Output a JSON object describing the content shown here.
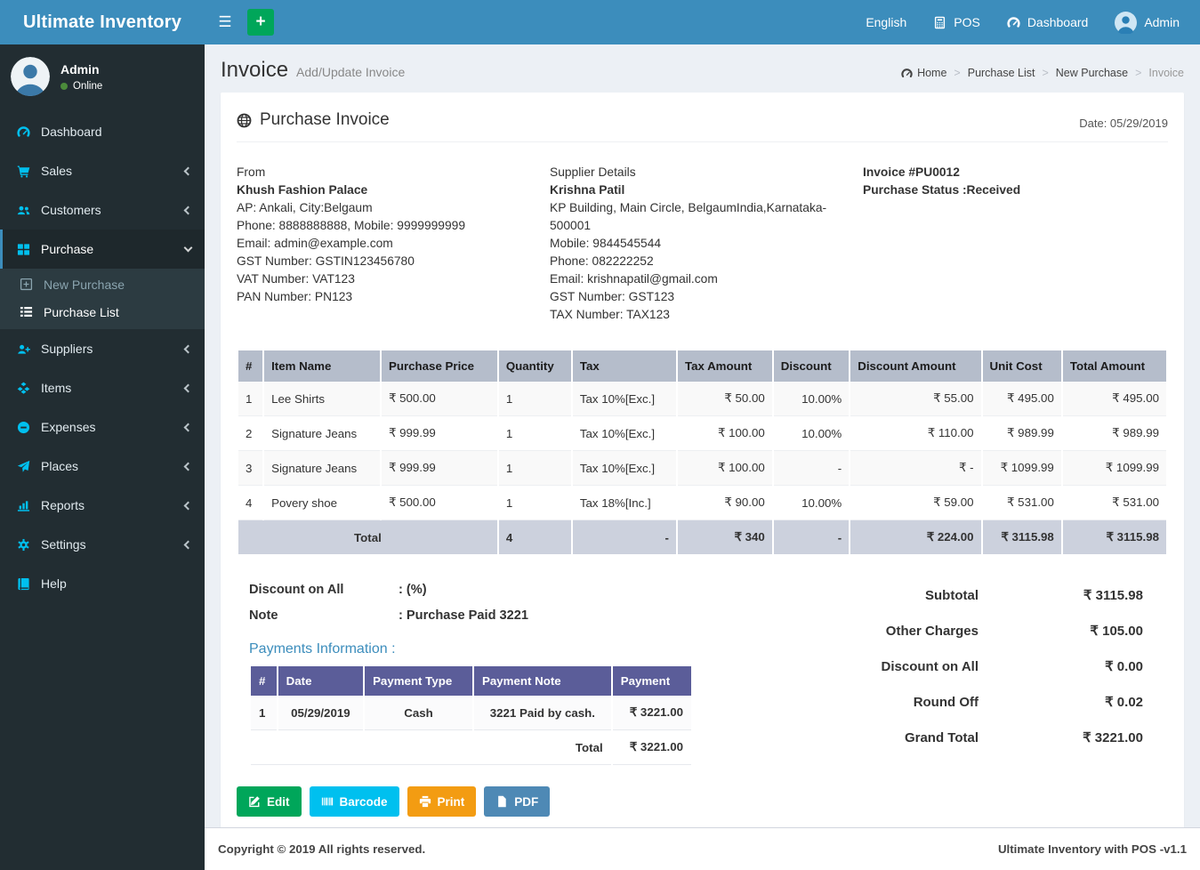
{
  "app": {
    "brand": "Ultimate Inventory",
    "footer_left": "Copyright © 2019 All rights reserved.",
    "footer_right": "Ultimate Inventory with POS -v1.1"
  },
  "colors": {
    "navbar": "#3c8dbc",
    "sidebar": "#222d32",
    "sidebar_icon_accent": "#00c0ef",
    "items_header": "#b5bdcb",
    "items_total_row": "#ccd1dd",
    "payments_header": "#5b5d99",
    "online_dot": "#4b8b3b"
  },
  "navbar": {
    "menu_icon": "☰",
    "plus_label": "+",
    "items": [
      {
        "label": "English"
      },
      {
        "label": "POS",
        "icon": "calculator-icon"
      },
      {
        "label": "Dashboard",
        "icon": "gauge-icon"
      },
      {
        "label": "Admin",
        "icon": "user-avatar-icon"
      }
    ]
  },
  "sidebar": {
    "user": {
      "name": "Admin",
      "status": "Online"
    },
    "items": [
      {
        "icon": "gauge-icon",
        "label": "Dashboard"
      },
      {
        "icon": "cart-icon",
        "label": "Sales",
        "chevron": "left"
      },
      {
        "icon": "users-icon",
        "label": "Customers",
        "chevron": "left"
      },
      {
        "icon": "grid-icon",
        "label": "Purchase",
        "chevron": "down",
        "active": true,
        "submenu": [
          {
            "icon": "plus-square-icon",
            "label": "New Purchase"
          },
          {
            "icon": "list-icon",
            "label": "Purchase List",
            "active": true
          }
        ]
      },
      {
        "icon": "user-plus-icon",
        "label": "Suppliers",
        "chevron": "left"
      },
      {
        "icon": "cubes-icon",
        "label": "Items",
        "chevron": "left"
      },
      {
        "icon": "minus-circle-icon",
        "label": "Expenses",
        "chevron": "left"
      },
      {
        "icon": "send-icon",
        "label": "Places",
        "chevron": "left"
      },
      {
        "icon": "chart-icon",
        "label": "Reports",
        "chevron": "left"
      },
      {
        "icon": "gears-icon",
        "label": "Settings",
        "chevron": "left"
      },
      {
        "icon": "book-icon",
        "label": "Help"
      }
    ]
  },
  "page": {
    "title": "Invoice",
    "subtitle": "Add/Update Invoice",
    "breadcrumb": [
      "Home",
      "Purchase List",
      "New Purchase",
      "Invoice"
    ]
  },
  "invoice": {
    "card_title": "Purchase Invoice",
    "date_label": "Date: 05/29/2019",
    "from": {
      "heading": "From",
      "name": "Khush Fashion Palace",
      "lines": [
        "AP: Ankali, City:Belgaum",
        "Phone: 8888888888, Mobile: 9999999999",
        "Email: admin@example.com",
        "GST Number: GSTIN123456780",
        "VAT Number: VAT123",
        "PAN Number: PN123"
      ]
    },
    "supplier": {
      "heading": "Supplier Details",
      "name": "Krishna Patil",
      "lines": [
        "KP Building, Main Circle, BelgaumIndia,Karnataka-500001",
        "Mobile: 9844545544",
        "Phone: 082222252",
        "Email: krishnapatil@gmail.com",
        "GST Number: GST123",
        "TAX Number: TAX123"
      ]
    },
    "meta": {
      "number": "Invoice #PU0012",
      "status": "Purchase Status :Received"
    }
  },
  "items_table": {
    "headers": [
      "#",
      "Item Name",
      "Purchase Price",
      "Quantity",
      "Tax",
      "Tax Amount",
      "Discount",
      "Discount Amount",
      "Unit Cost",
      "Total Amount"
    ],
    "rows": [
      [
        "1",
        "Lee Shirts",
        "₹ 500.00",
        "1",
        "Tax 10%[Exc.]",
        "₹ 50.00",
        "10.00%",
        "₹ 55.00",
        "₹ 495.00",
        "₹ 495.00"
      ],
      [
        "2",
        "Signature Jeans",
        "₹ 999.99",
        "1",
        "Tax 10%[Exc.]",
        "₹ 100.00",
        "10.00%",
        "₹ 110.00",
        "₹ 989.99",
        "₹ 989.99"
      ],
      [
        "3",
        "Signature Jeans",
        "₹ 999.99",
        "1",
        "Tax 10%[Exc.]",
        "₹ 100.00",
        "-",
        "₹ -",
        "₹ 1099.99",
        "₹ 1099.99"
      ],
      [
        "4",
        "Povery shoe",
        "₹ 500.00",
        "1",
        "Tax 18%[Inc.]",
        "₹ 90.00",
        "10.00%",
        "₹ 59.00",
        "₹ 531.00",
        "₹ 531.00"
      ]
    ],
    "total_row": {
      "label": "Total",
      "quantity": "4",
      "tax": "-",
      "tax_amount": "₹ 340",
      "discount": "-",
      "discount_amount": "₹ 224.00",
      "unit_cost": "₹ 3115.98",
      "total_amount": "₹ 3115.98"
    }
  },
  "extras": {
    "discount_label": "Discount on All",
    "discount_value": ": (%)",
    "note_label": "Note",
    "note_value": ": Purchase Paid 3221"
  },
  "payments": {
    "heading": "Payments Information :",
    "headers": [
      "#",
      "Date",
      "Payment Type",
      "Payment Note",
      "Payment"
    ],
    "rows": [
      [
        "1",
        "05/29/2019",
        "Cash",
        "3221 Paid by cash.",
        "₹ 3221.00"
      ]
    ],
    "total_label": "Total",
    "total_value": "₹ 3221.00"
  },
  "summary": {
    "rows": [
      [
        "Subtotal",
        "₹ 3115.98"
      ],
      [
        "Other Charges",
        "₹ 105.00"
      ],
      [
        "Discount on All",
        "₹ 0.00"
      ],
      [
        "Round Off",
        "₹ 0.02"
      ],
      [
        "Grand Total",
        "₹ 3221.00"
      ]
    ]
  },
  "actions": [
    {
      "icon": "edit-icon",
      "label": "Edit",
      "color": "#00a65a"
    },
    {
      "icon": "barcode-icon",
      "label": "Barcode",
      "color": "#00c0ef"
    },
    {
      "icon": "print-icon",
      "label": "Print",
      "color": "#f39c12"
    },
    {
      "icon": "pdf-icon",
      "label": "PDF",
      "color": "#4e89b5"
    }
  ]
}
